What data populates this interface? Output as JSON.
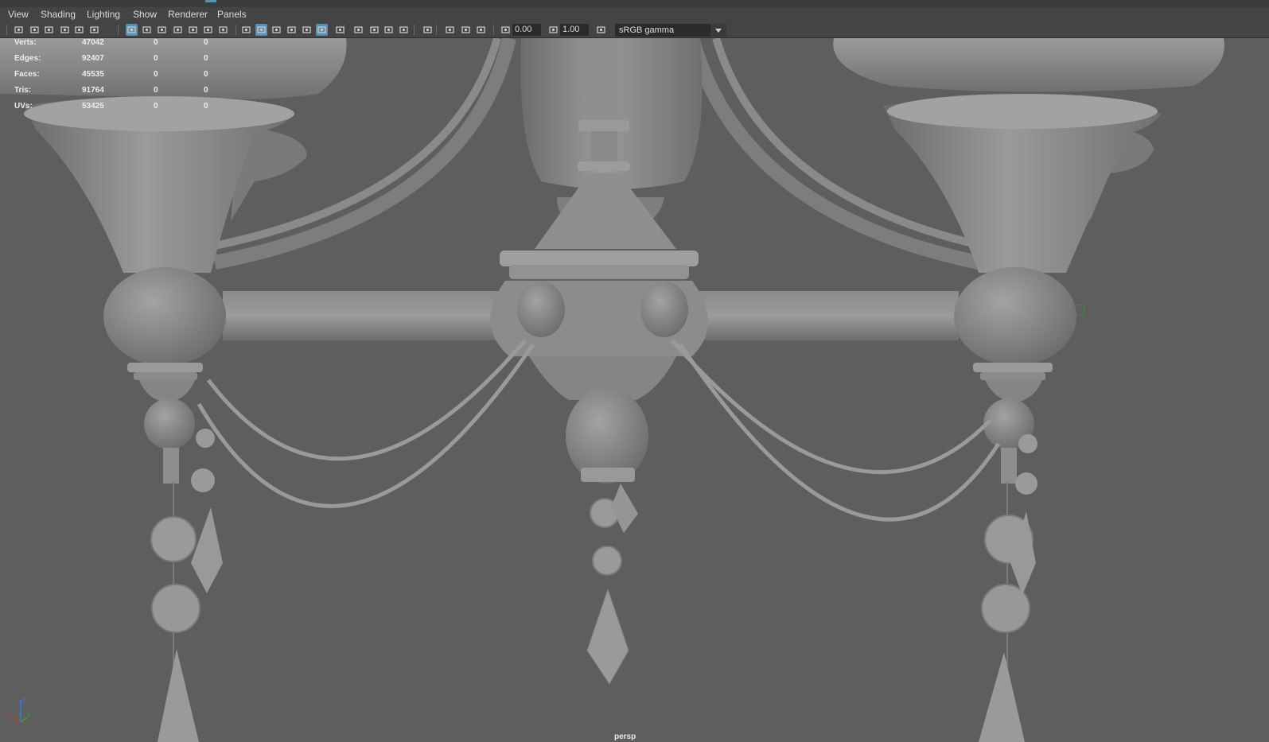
{
  "menu": {
    "items": [
      "View",
      "Shading",
      "Lighting",
      "Show",
      "Renderer",
      "Panels"
    ]
  },
  "toolbar": {
    "exposure_value": "0.00",
    "gamma_value": "1.00",
    "color_space": "sRGB gamma",
    "icons": [
      "camera-icon",
      "camera-lock-icon",
      "camera-attributes-icon",
      "bookmark-icon",
      "image-plane-icon",
      "grease-pencil-icon",
      "grid-icon",
      "film-gate-icon",
      "resolution-gate-icon",
      "gate-mask-icon",
      "field-chart-icon",
      "safe-action-icon",
      "safe-title-icon",
      "wireframe-icon",
      "smooth-shade-icon",
      "wireframe-on-shaded-icon",
      "textured-icon",
      "xray-icon",
      "use-lights-icon",
      "shadows-icon",
      "screen-space-ao-icon",
      "motion-blur-icon",
      "anti-aliasing-icon",
      "depth-of-field-icon",
      "isolate-select-icon",
      "xray-joints-icon",
      "xray-active-icon",
      "backface-icon",
      "exposure-icon",
      "gamma-icon",
      "color-management-icon"
    ]
  },
  "hud": {
    "rows": [
      {
        "label": "Verts:",
        "value": "47042",
        "a": "0",
        "b": "0"
      },
      {
        "label": "Edges:",
        "value": "92407",
        "a": "0",
        "b": "0"
      },
      {
        "label": "Faces:",
        "value": "45535",
        "a": "0",
        "b": "0"
      },
      {
        "label": "Tris:",
        "value": "91764",
        "a": "0",
        "b": "0"
      },
      {
        "label": "UVs:",
        "value": "53425",
        "a": "0",
        "b": "0"
      }
    ]
  },
  "camera": {
    "name": "persp"
  },
  "axis": {
    "x": "x",
    "y": "y",
    "z": "z"
  },
  "colors": {
    "viewport_bg": "#5e5e5e",
    "ui_bg": "#444444",
    "active_icon": "#5d8fb0",
    "model": "#8c8c8c"
  }
}
